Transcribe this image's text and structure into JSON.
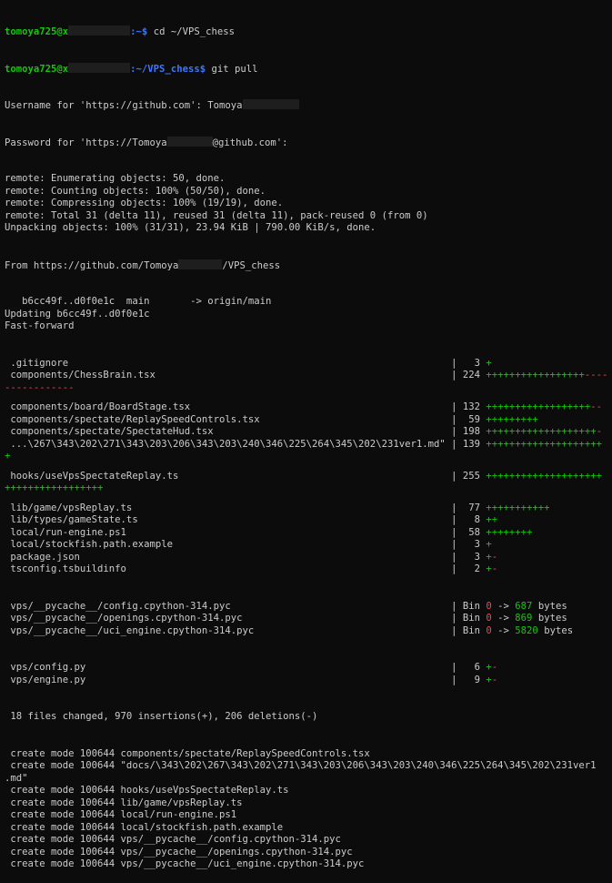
{
  "colors": {
    "background": "#0c0c0c",
    "text": "#cccccc",
    "prompt": "#16c60c",
    "path": "#3b78ff",
    "plus": "#16c60c",
    "minus": "#e74856"
  },
  "prompts": [
    {
      "user": "tomoya725@x",
      "path": ":~$",
      "cmd": " cd ~/VPS_chess"
    },
    {
      "user": "tomoya725@x",
      "path": ":~/VPS_chess$",
      "cmd": " git pull"
    }
  ],
  "auth": {
    "username_prefix": "Username for 'https://github.com': Tomoya",
    "password_prefix": "Password for 'https://Tomoya",
    "password_suffix": "@github.com':"
  },
  "remote_lines": [
    "remote: Enumerating objects: 50, done.",
    "remote: Counting objects: 100% (50/50), done.",
    "remote: Compressing objects: 100% (19/19), done.",
    "remote: Total 31 (delta 11), reused 31 (delta 11), pack-reused 0 (from 0)",
    "Unpacking objects: 100% (31/31), 23.94 KiB | 790.00 KiB/s, done."
  ],
  "from": {
    "prefix": "From https://github.com/Tomoya",
    "suffix": "/VPS_chess"
  },
  "post_from": [
    "   b6cc49f..d0f0e1c  main       -> origin/main",
    "Updating b6cc49f..d0f0e1c",
    "Fast-forward"
  ],
  "diffstat": [
    {
      "file": " .gitignore                                                                  ",
      "sep": "|   3 ",
      "plus": "+",
      "minus": ""
    },
    {
      "file": " components/ChessBrain.tsx                                                   ",
      "sep": "| 224 ",
      "plus": "+++++++++++++++++",
      "minus": "----",
      "wrap": "------------"
    },
    {
      "file": " components/board/BoardStage.tsx                                             ",
      "sep": "| 132 ",
      "plus": "++++++++++++++++++",
      "minus": "--"
    },
    {
      "file": " components/spectate/ReplaySpeedControls.tsx                                 ",
      "sep": "|  59 ",
      "plus": "+++++++++",
      "minus": ""
    },
    {
      "file": " components/spectate/SpectateHud.tsx                                         ",
      "sep": "| 198 ",
      "plus": "+++++++++++++++++++",
      "minus": "-"
    },
    {
      "file": " ...\\267\\343\\202\\271\\343\\203\\206\\343\\203\\240\\346\\225\\264\\345\\202\\231ver1.md\"",
      "sep": " | 139 ",
      "plus": "++++++++++++++++++++",
      "minus": "",
      "wrap_plus": "+"
    },
    {
      "file": " hooks/useVpsSpectateReplay.ts                                               ",
      "sep": "| 255 ",
      "plus": "++++++++++++++++++++",
      "minus": "",
      "wrap_plus": "+++++++++++++++++"
    },
    {
      "file": " lib/game/vpsReplay.ts                                                       ",
      "sep": "|  77 ",
      "plus": "+++++++++++",
      "minus": ""
    },
    {
      "file": " lib/types/gameState.ts                                                      ",
      "sep": "|   8 ",
      "plus": "++",
      "minus": ""
    },
    {
      "file": " local/run-engine.ps1                                                        ",
      "sep": "|  58 ",
      "plus": "++++++++",
      "minus": ""
    },
    {
      "file": " local/stockfish.path.example                                                ",
      "sep": "|   3 ",
      "plus": "+",
      "minus": ""
    },
    {
      "file": " package.json                                                                ",
      "sep": "|   3 ",
      "plus": "+",
      "minus": "-"
    },
    {
      "file": " tsconfig.tsbuildinfo                                                        ",
      "sep": "|   2 ",
      "plus": "+",
      "minus": "-"
    }
  ],
  "binaries": [
    {
      "file": " vps/__pycache__/config.cpython-314.pyc                                      ",
      "sep": "| Bin ",
      "old": "0",
      "arrow": " -> ",
      "new": "687",
      "unit": " bytes"
    },
    {
      "file": " vps/__pycache__/openings.cpython-314.pyc                                    ",
      "sep": "| Bin ",
      "old": "0",
      "arrow": " -> ",
      "new": "869",
      "unit": " bytes"
    },
    {
      "file": " vps/__pycache__/uci_engine.cpython-314.pyc                                  ",
      "sep": "| Bin ",
      "old": "0",
      "arrow": " -> ",
      "new": "5820",
      "unit": " bytes"
    }
  ],
  "tail_stats": [
    {
      "file": " vps/config.py                                                               ",
      "sep": "|   6 ",
      "plus": "+",
      "minus": "-"
    },
    {
      "file": " vps/engine.py                                                               ",
      "sep": "|   9 ",
      "plus": "+",
      "minus": "-"
    }
  ],
  "summary": " 18 files changed, 970 insertions(+), 206 deletions(-)",
  "create_lines": [
    " create mode 100644 components/spectate/ReplaySpeedControls.tsx",
    " create mode 100644 \"docs/\\343\\202\\267\\343\\202\\271\\343\\203\\206\\343\\203\\240\\346\\225\\264\\345\\202\\231ver1",
    ".md\"",
    " create mode 100644 hooks/useVpsSpectateReplay.ts",
    " create mode 100644 lib/game/vpsReplay.ts",
    " create mode 100644 local/run-engine.ps1",
    " create mode 100644 local/stockfish.path.example",
    " create mode 100644 vps/__pycache__/config.cpython-314.pyc",
    " create mode 100644 vps/__pycache__/openings.cpython-314.pyc",
    " create mode 100644 vps/__pycache__/uci_engine.cpython-314.pyc"
  ]
}
